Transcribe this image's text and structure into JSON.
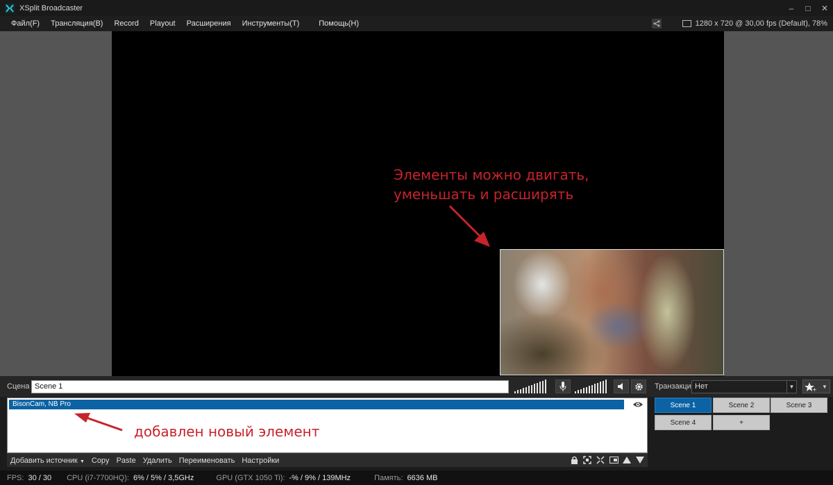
{
  "window": {
    "title": "XSplit Broadcaster",
    "controls": [
      "–",
      "□",
      "✕"
    ]
  },
  "menu": {
    "items": [
      "Файл(F)",
      "Трансляция(B)",
      "Record",
      "Playout",
      "Расширения",
      "Инструменты(T)",
      "Помощь(H)"
    ],
    "resolution": "1280 x 720 @ 30,00 fps (Default), 78%"
  },
  "stage": {
    "annotation_top": "Элементы можно двигать,\nуменьшать и расширять",
    "annotation_color": "#c7232b"
  },
  "scene_bar": {
    "label": "Сцена",
    "scene_name": "Scene 1",
    "transition_label": "Транзакция",
    "transition_value": "Нет"
  },
  "sources": {
    "items": [
      {
        "name": "BisonCam, NB Pro",
        "selected": true,
        "visible": true
      }
    ],
    "annotation_bottom": "добавлен новый элемент"
  },
  "source_toolbar": {
    "add_source": "Добавить источник",
    "copy": "Copy",
    "paste": "Paste",
    "delete": "Удалить",
    "rename": "Переименовать",
    "settings": "Настройки"
  },
  "scenes": {
    "buttons": [
      "Scene 1",
      "Scene 2",
      "Scene 3",
      "Scene 4",
      "+"
    ],
    "active": "Scene 1",
    "accent": "#0b62a4"
  },
  "status": {
    "fps_label": "FPS:",
    "fps_value": "30 / 30",
    "cpu_label": "CPU (i7-7700HQ):",
    "cpu_value": "6% / 5% / 3,5GHz",
    "gpu_label": "GPU (GTX 1050 Ti):",
    "gpu_value": "-% / 9% / 139MHz",
    "mem_label": "Память:",
    "mem_value": "6636 MB"
  }
}
